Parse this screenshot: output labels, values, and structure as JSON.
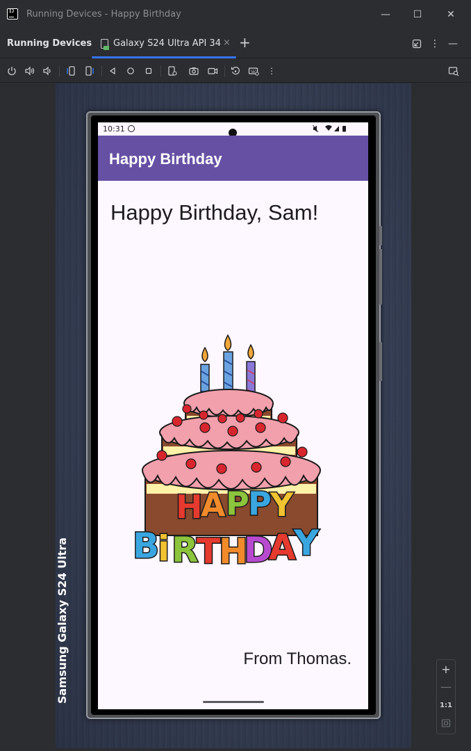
{
  "window": {
    "title": "Running Devices - Happy Birthday",
    "minimize_glyph": "—",
    "maximize_glyph": "☐",
    "close_glyph": "✕"
  },
  "tool_window": {
    "title": "Running Devices",
    "tabs": [
      {
        "label": "Galaxy S24 Ultra API 34",
        "close_glyph": "×",
        "selected": true
      }
    ],
    "add_tab_glyph": "+",
    "more_glyph": "⋮",
    "hide_glyph": "—"
  },
  "toolbar": {
    "icons": [
      "power-icon",
      "volume-up-icon",
      "volume-down-icon",
      "rotate-left-icon",
      "rotate-right-icon",
      "back-icon",
      "home-icon",
      "overview-icon",
      "device-info-icon",
      "screenshot-icon",
      "screen-record-icon",
      "reset-icon",
      "keyboard-icon",
      "more-icon",
      "device-mirror-icon"
    ],
    "more_glyph": "⋮"
  },
  "device": {
    "brand_text": "Samsung Galaxy S24 Ultra",
    "status_bar": {
      "time": "10:31",
      "icons_text": "🔇▾◢▮"
    },
    "app": {
      "title": "Happy Birthday",
      "greeting": "Happy Birthday, Sam!",
      "signature": "From Thomas."
    }
  },
  "zoom": {
    "zoom_in": "+",
    "zoom_out": "—",
    "actual_size": "1:1"
  },
  "colors": {
    "app_bar": "#6650a4",
    "screen_background": "#fdf7ff",
    "tab_underline": "#3574f0",
    "ide_background": "#2b2d30"
  }
}
